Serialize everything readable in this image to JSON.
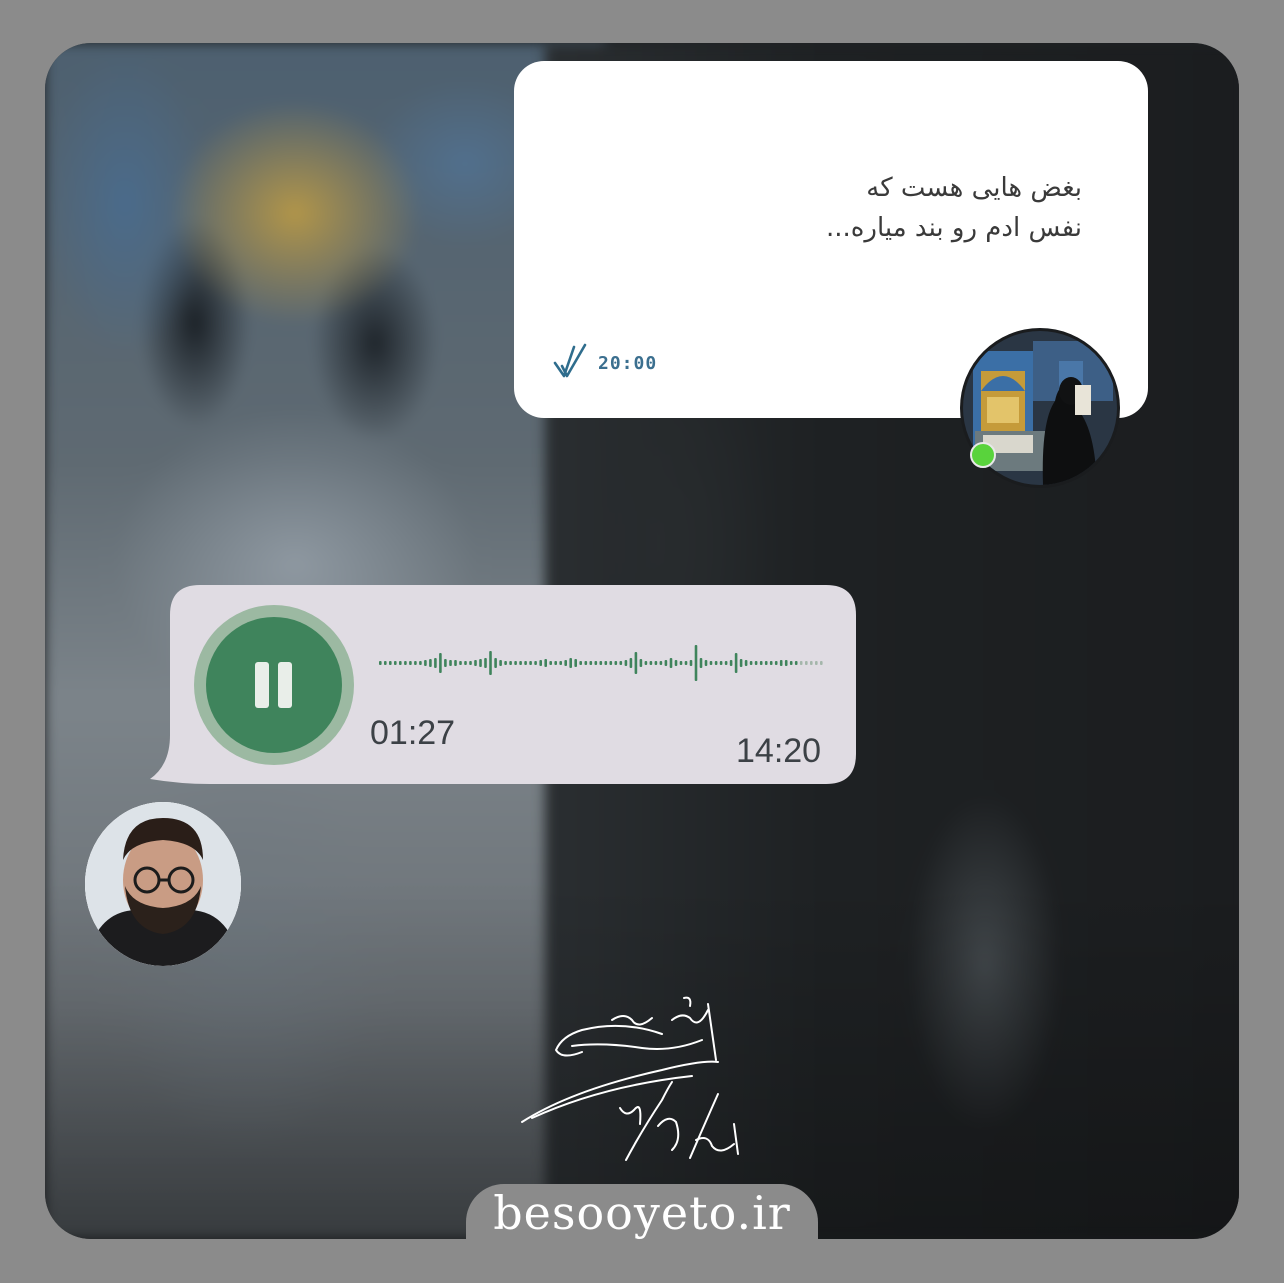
{
  "message": {
    "line1": "بغض هایی هست که",
    "line2": "نفس ادم رو بند میاره...",
    "time": "20:00",
    "status_icon": "double-check-icon"
  },
  "contact": {
    "avatar_icon": "shrine-avatar-icon",
    "online": true,
    "online_color": "#59d33c"
  },
  "voice_message": {
    "elapsed": "01:27",
    "time": "14:20",
    "state": "playing",
    "control_icon": "pause-icon",
    "accent_color": "#3f845c"
  },
  "user": {
    "avatar_icon": "user-avatar-icon"
  },
  "signature": {
    "text": "نویسنده: محمد حسین سبزه ئی",
    "date": "۲۸ خرداد ۱۴۰۱"
  },
  "site": {
    "url": "besooyeto.ir"
  }
}
